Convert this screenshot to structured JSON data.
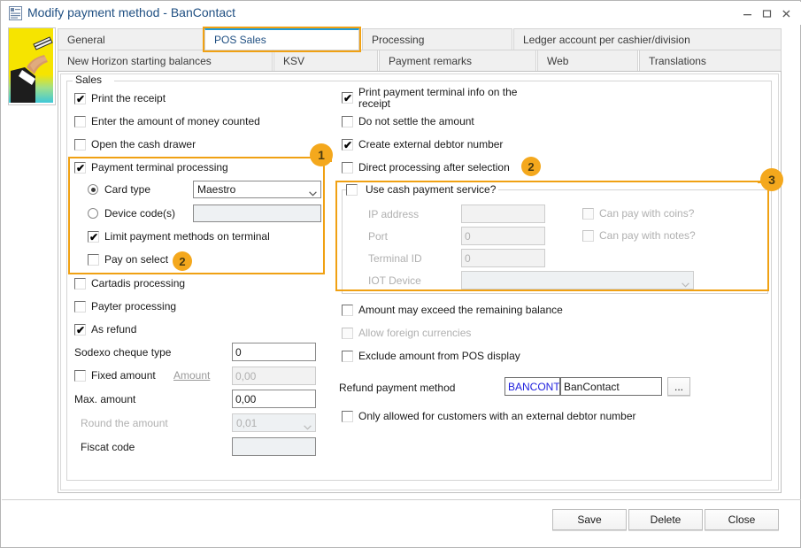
{
  "window": {
    "title": "Modify payment method - BanContact",
    "icon": "document-icon",
    "controls": {
      "minimize": "minimize-icon",
      "maximize": "maximize-icon",
      "close": "close-icon"
    }
  },
  "tabs": {
    "row1": [
      {
        "label": "General",
        "active": false
      },
      {
        "label": "POS Sales",
        "active": true
      },
      {
        "label": "Processing",
        "active": false
      },
      {
        "label": "Ledger account per cashier/division",
        "active": false
      }
    ],
    "row2": [
      {
        "label": "New Horizon starting balances",
        "active": false
      },
      {
        "label": "KSV",
        "active": false
      },
      {
        "label": "Payment remarks",
        "active": false
      },
      {
        "label": "Web",
        "active": false
      },
      {
        "label": "Translations",
        "active": false
      }
    ]
  },
  "groups": {
    "sales_legend": "Sales",
    "cash_service_legend": "Use cash payment service?"
  },
  "left_column": {
    "print_receipt": {
      "label": "Print the receipt",
      "checked": true
    },
    "enter_amount_counted": {
      "label": "Enter the amount of money counted",
      "checked": false
    },
    "open_cash_drawer": {
      "label": "Open the cash drawer",
      "checked": false
    },
    "payment_terminal_processing": {
      "label": "Payment terminal processing",
      "checked": true
    },
    "card_type_radio": {
      "label": "Card type",
      "selected": true
    },
    "card_type_value": "Maestro",
    "device_codes_radio": {
      "label": "Device code(s)",
      "selected": false
    },
    "device_codes_value": "",
    "limit_payment_methods": {
      "label": "Limit payment methods on terminal",
      "checked": true
    },
    "pay_on_select": {
      "label": "Pay on select",
      "checked": false
    },
    "cartadis_processing": {
      "label": "Cartadis processing",
      "checked": false
    },
    "payter_processing": {
      "label": "Payter processing",
      "checked": false
    },
    "as_refund": {
      "label": "As refund",
      "checked": true
    },
    "sodexo_cheque_type": {
      "label": "Sodexo cheque type",
      "value": "0"
    },
    "fixed_amount": {
      "label": "Fixed amount",
      "checked": false
    },
    "amount_link": "Amount",
    "amount_value": "0,00",
    "max_amount": {
      "label": "Max. amount",
      "value": "0,00"
    },
    "round_the_amount": {
      "label": "Round the amount",
      "value": "0,01"
    },
    "fiscat_code": {
      "label": "Fiscat code",
      "value": ""
    }
  },
  "right_column": {
    "print_terminal_info": {
      "label": "Print payment terminal info on the receipt",
      "checked": true
    },
    "do_not_settle": {
      "label": "Do not settle the amount",
      "checked": false
    },
    "create_external_debtor": {
      "label": "Create external debtor number",
      "checked": true
    },
    "direct_processing": {
      "label": "Direct processing after selection",
      "checked": false
    },
    "use_cash_payment_service": {
      "label": "Use cash payment service?",
      "checked": false
    },
    "ip_address": {
      "label": "IP address",
      "value": ""
    },
    "port": {
      "label": "Port",
      "value": "0"
    },
    "terminal_id": {
      "label": "Terminal ID",
      "value": "0"
    },
    "iot_device": {
      "label": "IOT Device",
      "value": ""
    },
    "can_pay_coins": {
      "label": "Can pay with coins?",
      "checked": false
    },
    "can_pay_notes": {
      "label": "Can pay with notes?",
      "checked": false
    },
    "amount_may_exceed": {
      "label": "Amount may exceed the remaining balance",
      "checked": false
    },
    "allow_foreign_currencies": {
      "label": "Allow foreign currencies",
      "checked": false
    },
    "exclude_amount_pos": {
      "label": "Exclude amount from POS display",
      "checked": false
    },
    "refund_payment_method": {
      "label": "Refund payment method",
      "code": "BANCONTA",
      "name": "BanContact",
      "browse": "..."
    },
    "only_allowed_external_debtor": {
      "label": "Only allowed for customers with an external debtor number",
      "checked": false
    }
  },
  "footer": {
    "save": "Save",
    "delete": "Delete",
    "close": "Close"
  },
  "annotations": {
    "badge1": "1",
    "badge2a": "2",
    "badge2b": "2",
    "badge3": "3"
  },
  "colors": {
    "accent_orange": "#f0a113",
    "badge_orange": "#f4a81d",
    "tab_active_top": "#1e9bd7",
    "title_blue": "#1f4f82",
    "link_blue": "#2020dd"
  }
}
